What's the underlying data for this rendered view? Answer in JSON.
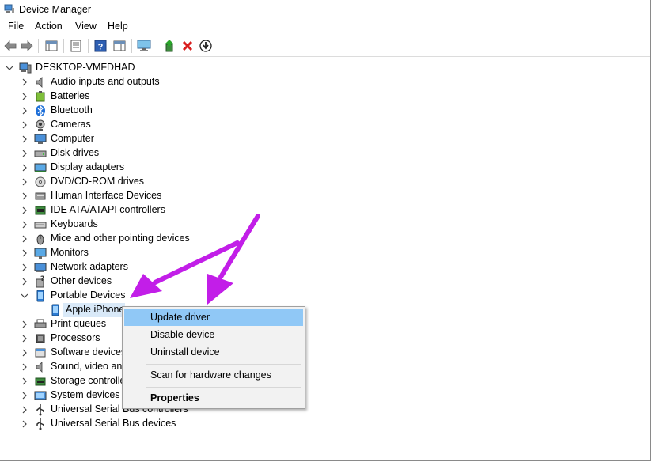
{
  "window": {
    "title": "Device Manager"
  },
  "menu": [
    "File",
    "Action",
    "View",
    "Help"
  ],
  "tree": {
    "root": "DESKTOP-VMFDHAD",
    "categories": [
      {
        "label": "Audio inputs and outputs",
        "icon": "speaker-icon"
      },
      {
        "label": "Batteries",
        "icon": "battery-icon"
      },
      {
        "label": "Bluetooth",
        "icon": "bluetooth-icon"
      },
      {
        "label": "Cameras",
        "icon": "camera-icon"
      },
      {
        "label": "Computer",
        "icon": "computer-icon"
      },
      {
        "label": "Disk drives",
        "icon": "disk-drive-icon"
      },
      {
        "label": "Display adapters",
        "icon": "display-adapter-icon"
      },
      {
        "label": "DVD/CD-ROM drives",
        "icon": "dvd-drive-icon"
      },
      {
        "label": "Human Interface Devices",
        "icon": "hid-icon"
      },
      {
        "label": "IDE ATA/ATAPI controllers",
        "icon": "ide-controller-icon"
      },
      {
        "label": "Keyboards",
        "icon": "keyboard-icon"
      },
      {
        "label": "Mice and other pointing devices",
        "icon": "mouse-icon"
      },
      {
        "label": "Monitors",
        "icon": "monitor-icon"
      },
      {
        "label": "Network adapters",
        "icon": "network-adapter-icon"
      },
      {
        "label": "Other devices",
        "icon": "other-devices-icon"
      },
      {
        "label": "Portable Devices",
        "icon": "portable-device-icon",
        "expanded": true
      },
      {
        "label": "Apple iPhone",
        "icon": "phone-icon",
        "child": true
      },
      {
        "label": "Print queues",
        "icon": "printer-icon"
      },
      {
        "label": "Processors",
        "icon": "processor-icon"
      },
      {
        "label": "Software devices",
        "icon": "software-device-icon"
      },
      {
        "label": "Sound, video and game controllers",
        "icon": "sound-controller-icon"
      },
      {
        "label": "Storage controllers",
        "icon": "storage-controller-icon"
      },
      {
        "label": "System devices",
        "icon": "system-device-icon"
      },
      {
        "label": "Universal Serial Bus controllers",
        "icon": "usb-icon"
      },
      {
        "label": "Universal Serial Bus devices",
        "icon": "usb-device-icon"
      }
    ]
  },
  "context_menu": {
    "update": "Update driver",
    "disable": "Disable device",
    "uninstall": "Uninstall device",
    "scan": "Scan for hardware changes",
    "properties": "Properties"
  },
  "colors": {
    "highlight": "#90c8f6",
    "arrow": "#c21ee8",
    "menu_bg": "#f2f2f2"
  }
}
